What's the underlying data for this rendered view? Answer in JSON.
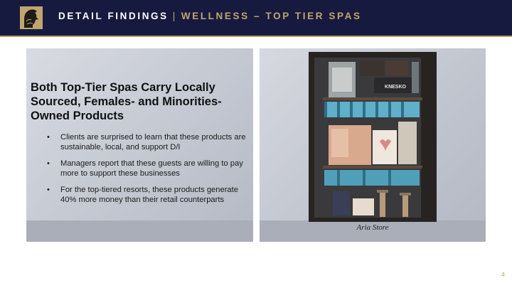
{
  "header": {
    "title": "DETAIL FINDINGS",
    "separator": "|",
    "subtitle": "WELLNESS – TOP TIER SPAS"
  },
  "content": {
    "heading": "Both Top-Tier Spas Carry Locally Sourced, Females- and Minorities-Owned Products",
    "bullets": [
      "Clients are surprised to learn that these products are sustainable, local, and support D/I",
      "Managers report that these guests are willing to pay more to support these businesses",
      "For the top-tiered resorts, these products generate 40% more money than their retail counterparts"
    ]
  },
  "photo": {
    "caption": "Aria Store",
    "brand_label": "KNESKO"
  },
  "footer": {
    "page_number": "4"
  },
  "colors": {
    "header_bg": "#171a3f",
    "accent_gold": "#c2a56e",
    "panel_gray": "#c7cbd4"
  }
}
